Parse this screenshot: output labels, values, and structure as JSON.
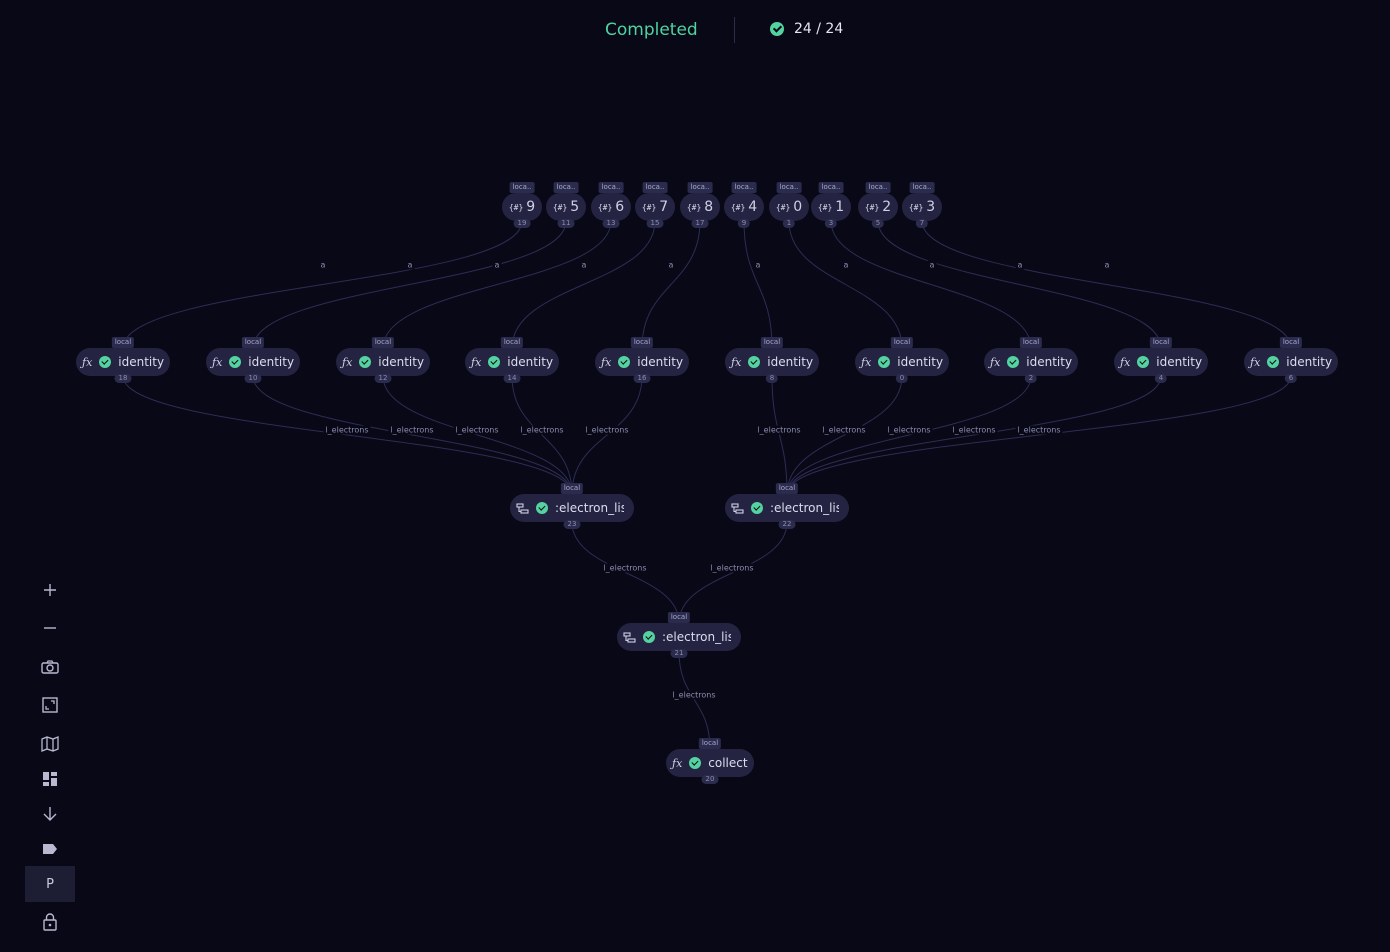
{
  "header": {
    "status": "Completed",
    "progress": "24 / 24"
  },
  "colors": {
    "background": "#080816",
    "node": "#242442",
    "success": "#54d3a0",
    "edge": "#2d2d55"
  },
  "nodes": {
    "params": [
      {
        "tag": "loca..",
        "value": "9",
        "id": "19"
      },
      {
        "tag": "loca..",
        "value": "5",
        "id": "11"
      },
      {
        "tag": "loca..",
        "value": "6",
        "id": "13"
      },
      {
        "tag": "loca..",
        "value": "7",
        "id": "15"
      },
      {
        "tag": "loca..",
        "value": "8",
        "id": "17"
      },
      {
        "tag": "loca..",
        "value": "4",
        "id": "9"
      },
      {
        "tag": "loca..",
        "value": "0",
        "id": "1"
      },
      {
        "tag": "loca..",
        "value": "1",
        "id": "3"
      },
      {
        "tag": "loca..",
        "value": "2",
        "id": "5"
      },
      {
        "tag": "loca..",
        "value": "3",
        "id": "7"
      }
    ],
    "param_icon": "{#}",
    "identity": [
      {
        "tag": "local",
        "label": "identity",
        "id": "18"
      },
      {
        "tag": "local",
        "label": "identity",
        "id": "10"
      },
      {
        "tag": "local",
        "label": "identity",
        "id": "12"
      },
      {
        "tag": "local",
        "label": "identity",
        "id": "14"
      },
      {
        "tag": "local",
        "label": "identity",
        "id": "16"
      },
      {
        "tag": "local",
        "label": "identity",
        "id": "8"
      },
      {
        "tag": "local",
        "label": "identity",
        "id": "0"
      },
      {
        "tag": "local",
        "label": "identity",
        "id": "2"
      },
      {
        "tag": "local",
        "label": "identity",
        "id": "4"
      },
      {
        "tag": "local",
        "label": "identity",
        "id": "6"
      }
    ],
    "func_icon": "ƒx",
    "sublists": [
      {
        "tag": "local",
        "label": ":electron_list:",
        "id": "23"
      },
      {
        "tag": "local",
        "label": ":electron_list:",
        "id": "22"
      },
      {
        "tag": "local",
        "label": ":electron_list:",
        "id": "21"
      }
    ],
    "collect": {
      "tag": "local",
      "label": "collect",
      "id": "20"
    }
  },
  "edge_labels": {
    "param_to_identity": "a",
    "to_list": "l_electrons"
  },
  "toolbar": [
    {
      "name": "zoom-in-button",
      "icon": "plus-icon"
    },
    {
      "name": "zoom-out-button",
      "icon": "minus-icon"
    },
    {
      "name": "screenshot-button",
      "icon": "camera-icon"
    },
    {
      "name": "fit-view-button",
      "icon": "fit-icon"
    },
    {
      "name": "minimap-button",
      "icon": "map-icon"
    },
    {
      "name": "layout-button",
      "icon": "dashboard-icon"
    },
    {
      "name": "direction-button",
      "icon": "arrow-down-icon"
    },
    {
      "name": "labels-button",
      "icon": "label-icon"
    },
    {
      "name": "parameters-button",
      "icon": "p-icon",
      "label": "P",
      "active": true
    },
    {
      "name": "lock-button",
      "icon": "lock-icon"
    }
  ]
}
